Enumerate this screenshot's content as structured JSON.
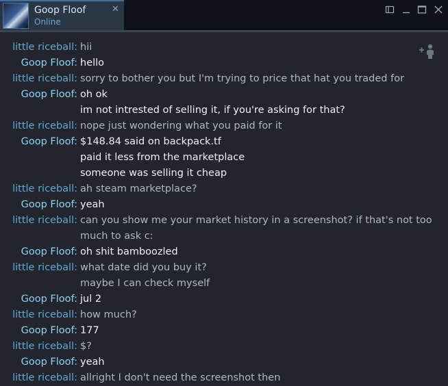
{
  "tab": {
    "name": "Goop Floof",
    "status": "Online",
    "close_glyph": "✕"
  },
  "window_controls": [
    "restore-icon",
    "minimize-icon",
    "maximize-icon",
    "close-icon"
  ],
  "colors": {
    "background": "#22252c",
    "titlebar": "#0f1318",
    "tab": "#2b3645",
    "sender_little_riceball": "#62a7d6",
    "sender_goop_floof": "#8fd0f5",
    "text_little_riceball": "#aeb7c3",
    "text_goop_floof": "#eef2f6"
  },
  "add_friend_icon": "add-friend-icon",
  "messages": [
    {
      "sender": "little riceball:",
      "text": "hii"
    },
    {
      "sender": "Goop Floof:",
      "text": "hello"
    },
    {
      "sender": "little riceball:",
      "text": "sorry to bother you but I'm trying to price that hat you traded for"
    },
    {
      "sender": "Goop Floof:",
      "text": "oh ok"
    },
    {
      "sender": "",
      "text": "im not intrested of selling it, if you're asking for that?"
    },
    {
      "sender": "little riceball:",
      "text": "nope just wondering what you paid for it"
    },
    {
      "sender": "Goop Floof:",
      "text": "$148.84 said on backpack.tf"
    },
    {
      "sender": "",
      "text": "paid it less from the marketplace"
    },
    {
      "sender": "",
      "text": "someone was selling it cheap"
    },
    {
      "sender": "little riceball:",
      "text": "ah steam marketplace?"
    },
    {
      "sender": "Goop Floof:",
      "text": "yeah"
    },
    {
      "sender": "little riceball:",
      "text": "can you show me your market history in a screenshot? if that's not too"
    },
    {
      "sender": "",
      "text": "much to ask c:"
    },
    {
      "sender": "Goop Floof:",
      "text": "oh shit bamboozled"
    },
    {
      "sender": "little riceball:",
      "text": "what date did you buy it?"
    },
    {
      "sender": "",
      "text": "maybe I can check myself"
    },
    {
      "sender": "Goop Floof:",
      "text": "jul 2"
    },
    {
      "sender": "little riceball:",
      "text": "how much?"
    },
    {
      "sender": "Goop Floof:",
      "text": "177"
    },
    {
      "sender": "little riceball:",
      "text": "$?"
    },
    {
      "sender": "Goop Floof:",
      "text": "yeah"
    },
    {
      "sender": "little riceball:",
      "text": "allright I don't need the screenshot then"
    }
  ]
}
